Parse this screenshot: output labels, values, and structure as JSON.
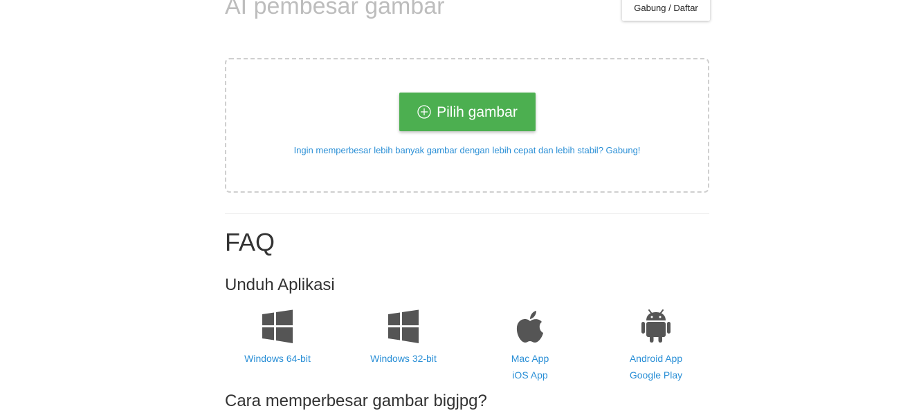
{
  "header": {
    "title": "AI pembesar gambar",
    "login_label": "Gabung / Daftar"
  },
  "upload": {
    "button_label": "Pilih gambar",
    "promo_text": "Ingin memperbesar lebih banyak gambar dengan lebih cepat dan lebih stabil? Gabung!"
  },
  "faq": {
    "title": "FAQ",
    "download_heading": "Unduh Aplikasi",
    "apps": [
      {
        "icon": "windows-icon",
        "links": [
          "Windows 64-bit"
        ]
      },
      {
        "icon": "windows-icon",
        "links": [
          "Windows 32-bit"
        ]
      },
      {
        "icon": "apple-icon",
        "links": [
          "Mac App",
          "iOS App"
        ]
      },
      {
        "icon": "android-icon",
        "links": [
          "Android App",
          "Google Play"
        ]
      }
    ],
    "howto_heading": "Cara memperbesar gambar bigjpg?"
  },
  "colors": {
    "accent_green": "#4caf50",
    "link_blue": "#2a8fd6",
    "title_gray": "#bdbdbd",
    "icon_gray": "#555555"
  }
}
